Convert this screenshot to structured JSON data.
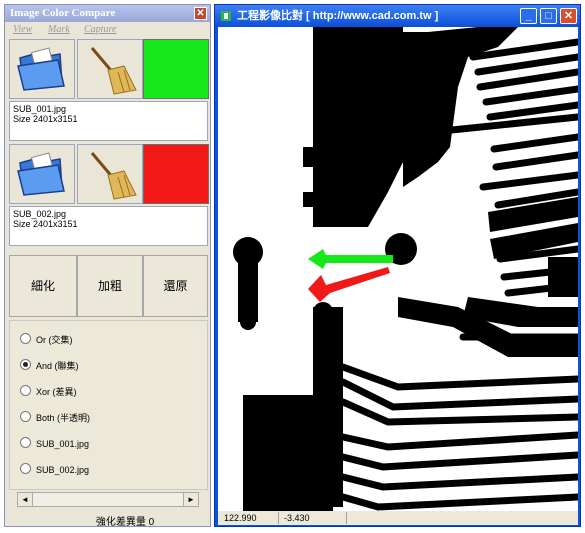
{
  "left_window": {
    "title": "Image Color Compare",
    "close": "✕",
    "menu": [
      "View",
      "Mark",
      "Capture"
    ],
    "image1": {
      "color": "#17e81c",
      "name": "SUB_001.jpg",
      "size": "Size 2401x3151"
    },
    "image2": {
      "color": "#f21818",
      "name": "SUB_002.jpg",
      "size": "Size 2401x3151"
    },
    "buttons": [
      "細化",
      "加粗",
      "還原"
    ],
    "options": [
      {
        "label": "Or (交集)",
        "selected": false
      },
      {
        "label": "And (聯集)",
        "selected": true
      },
      {
        "label": "Xor (差異)",
        "selected": false
      },
      {
        "label": "Both (半透明)",
        "selected": false
      },
      {
        "label": "SUB_001.jpg",
        "selected": false
      },
      {
        "label": "SUB_002.jpg",
        "selected": false
      }
    ],
    "scroll_left": "◄",
    "scroll_right": "►",
    "status": "強化差異量 0"
  },
  "right_window": {
    "title": "工程影像比對 [ http://www.cad.com.tw ]",
    "controls": {
      "minimize": "_",
      "maximize": "□",
      "close": "✕"
    },
    "status_x": "122.990",
    "status_y": "-3.430"
  }
}
